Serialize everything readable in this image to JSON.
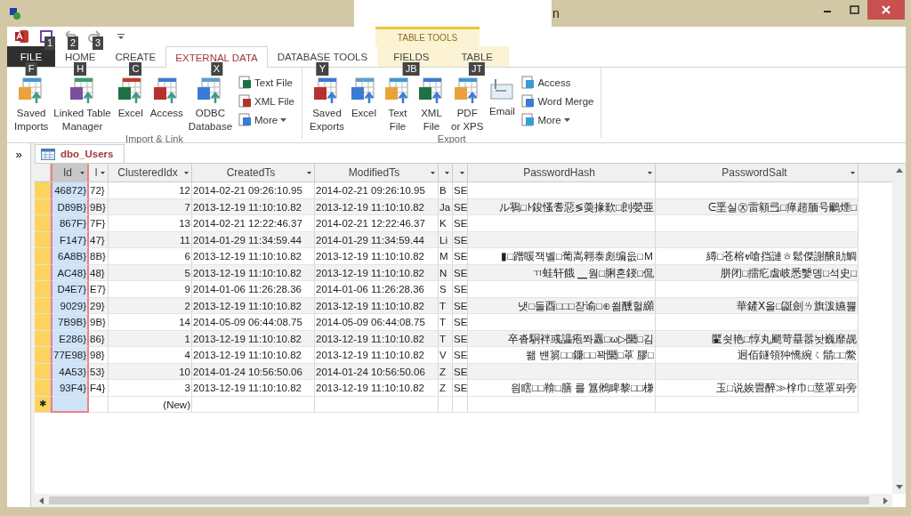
{
  "window": {
    "title": "n"
  },
  "quick_access": [
    {
      "keytip": "1"
    },
    {
      "keytip": "2"
    },
    {
      "keytip": "3"
    }
  ],
  "tabs": [
    {
      "label": "FILE",
      "keytip": "F",
      "selected": false,
      "kind": "file"
    },
    {
      "label": "HOME",
      "keytip": "H",
      "selected": false,
      "kind": "tab"
    },
    {
      "label": "CREATE",
      "keytip": "C",
      "selected": false,
      "kind": "tab"
    },
    {
      "label": "EXTERNAL DATA",
      "keytip": "X",
      "selected": true,
      "kind": "tab"
    },
    {
      "label": "DATABASE TOOLS",
      "keytip": "Y",
      "selected": false,
      "kind": "tab"
    },
    {
      "label": "FIELDS",
      "keytip": "JB",
      "selected": false,
      "kind": "context"
    },
    {
      "label": "TABLE",
      "keytip": "JT",
      "selected": false,
      "kind": "context"
    }
  ],
  "context_group": {
    "label": "TABLE TOOLS"
  },
  "ribbon": {
    "groups": [
      {
        "label": "Import & Link",
        "large": [
          {
            "label": "Saved\nImports"
          },
          {
            "label": "Linked Table\nManager"
          },
          {
            "label": "Excel"
          },
          {
            "label": "Access"
          },
          {
            "label": "ODBC\nDatabase"
          }
        ],
        "small": [
          {
            "label": "Text File",
            "menu": false
          },
          {
            "label": "XML File",
            "menu": false
          },
          {
            "label": "More",
            "menu": true
          }
        ]
      },
      {
        "label": "Export",
        "large": [
          {
            "label": "Saved\nExports"
          },
          {
            "label": "Excel"
          },
          {
            "label": "Text\nFile"
          },
          {
            "label": "XML\nFile"
          },
          {
            "label": "PDF\nor XPS"
          },
          {
            "label": "Email"
          }
        ],
        "small": [
          {
            "label": "Access",
            "menu": false
          },
          {
            "label": "Word Merge",
            "menu": false
          },
          {
            "label": "More",
            "menu": true
          }
        ]
      }
    ]
  },
  "nav_pane": {
    "toggle": "»"
  },
  "document_tab": {
    "label": "dbo_Users"
  },
  "table": {
    "columns": [
      {
        "label": "Id",
        "selected": true
      },
      {
        "label": "l",
        "selected": false
      },
      {
        "label": "ClusteredIdx",
        "selected": false
      },
      {
        "label": "CreatedTs",
        "selected": false
      },
      {
        "label": "ModifiedTs",
        "selected": false
      },
      {
        "selected": false
      },
      {
        "selected": false
      },
      {
        "label": "PasswordHash",
        "selected": false
      },
      {
        "label": "PasswordSalt",
        "selected": false
      }
    ],
    "rows": [
      {
        "id": "46872}",
        "column_2": "72}",
        "clustered_idx": "12",
        "created_ts": "2014-02-21 09:26:10.95",
        "modified_ts": "2014-02-21 09:26:10.95",
        "column_6": "B",
        "column_7": "SE"
      },
      {
        "id": "D89B}",
        "column_2": "9B}",
        "clustered_idx": "7",
        "created_ts": "2013-12-19 11:10:10.82",
        "modified_ts": "2013-12-19 11:10:10.82",
        "column_6": "Ja",
        "column_7": "SE",
        "password_hash": "ル䴇□ﾄ鋑慅耆惡≶羮掾歎□剆嫈亜",
        "password_salt": "ᕮ垩실㉨雷顡弖□瘅趦腼号鸍煙□"
      },
      {
        "id": "867F}",
        "column_2": "7F}",
        "clustered_idx": "13",
        "created_ts": "2014-02-21 12:22:46.37",
        "modified_ts": "2014-02-21 12:22:46.37",
        "column_6": "K",
        "column_7": "SE"
      },
      {
        "id": "F147}",
        "column_2": "47}",
        "clustered_idx": "11",
        "created_ts": "2014-01-29 11:34:59.44",
        "modified_ts": "2014-01-29 11:34:59.44",
        "column_6": "Li",
        "column_7": "SE"
      },
      {
        "id": "6A8B}",
        "column_2": "8B}",
        "clustered_idx": "6",
        "created_ts": "2013-12-19 11:10:10.82",
        "modified_ts": "2013-12-19 11:10:10.82",
        "column_6": "M",
        "column_7": "SE",
        "password_hash": "▮□蹭䁔잭볠□葡嵩翱泰彪编읎□Ｍ",
        "password_salt": "縳□苍榕ⱴ嗆挡謰ㅎ鬆傑謝醸勛鯛"
      },
      {
        "id": "AC48}",
        "column_2": "48}",
        "clustered_idx": "5",
        "created_ts": "2013-12-19 11:10:10.82",
        "modified_ts": "2013-12-19 11:10:10.82",
        "column_6": "N",
        "column_7": "SE",
        "password_hash": "ㄲ蛙轩餓 ▁웜□脷혼鋄□侃",
        "password_salt": "胼闭□擂疕虘岐悉嫛뎽□석史□"
      },
      {
        "id": "D4E7}",
        "column_2": "E7}",
        "clustered_idx": "9",
        "created_ts": "2014-01-06 11:26:28.36",
        "modified_ts": "2014-01-06 11:26:28.36",
        "column_6": "S",
        "column_7": "SE"
      },
      {
        "id": "9029}",
        "column_2": "29}",
        "clustered_idx": "2",
        "created_ts": "2013-12-19 11:10:10.82",
        "modified_ts": "2013-12-19 11:10:10.82",
        "column_6": "T",
        "column_7": "SE",
        "password_hash": "냇□둘酉□□□잗谕□⊕쐶醺헐纐",
        "password_salt": "華鏟Ⅹ올□鼮劍ㄌ旗泼嬿뿛"
      },
      {
        "id": "7B9B}",
        "column_2": "9B}",
        "clustered_idx": "14",
        "created_ts": "2014-05-09 06:44:08.75",
        "modified_ts": "2014-05-09 06:44:08.75",
        "column_6": "T",
        "column_7": "SE"
      },
      {
        "id": "E286}",
        "column_2": "86}",
        "clustered_idx": "1",
        "created_ts": "2013-12-19 11:10:10.82",
        "modified_ts": "2013-12-19 11:10:10.82",
        "column_6": "T",
        "column_7": "SE",
        "password_hash": "卒沓駧袢彧讄疱쫘纛□ω▷圞□김",
        "password_salt": "匷쇳艳□惇丸颵苛曅嚣놧巍靡觇"
      },
      {
        "id": "77E98}",
        "column_2": "98}",
        "clustered_idx": "4",
        "created_ts": "2013-12-19 11:10:10.82",
        "modified_ts": "2013-12-19 11:10:10.82",
        "column_6": "V",
        "column_7": "SE",
        "password_hash": "쐚 뱬篘□□鐮□□꽉圞□䓬 膠□",
        "password_salt": "迥佰鐩領狆憍綩ㄑ鬅□□鱉"
      },
      {
        "id": "4A53}",
        "column_2": "53}",
        "clustered_idx": "10",
        "created_ts": "2014-01-24 10:56:50.06",
        "modified_ts": "2014-01-24 10:56:50.06",
        "column_6": "Z",
        "column_7": "SE"
      },
      {
        "id": "93F4}",
        "column_2": "F4}",
        "clustered_idx": "3",
        "created_ts": "2013-12-19 11:10:10.82",
        "modified_ts": "2013-12-19 11:10:10.82",
        "column_6": "Z",
        "column_7": "SE",
        "password_hash": "읨瞎□□鞥□膳 를 簋鵂睥黎□□槏",
        "password_salt": "玉□说娭畳醉≫㮆巾□莖罩퐈旁"
      }
    ],
    "new_row": {
      "marker": "✱",
      "clustered_idx": "(New)"
    }
  }
}
